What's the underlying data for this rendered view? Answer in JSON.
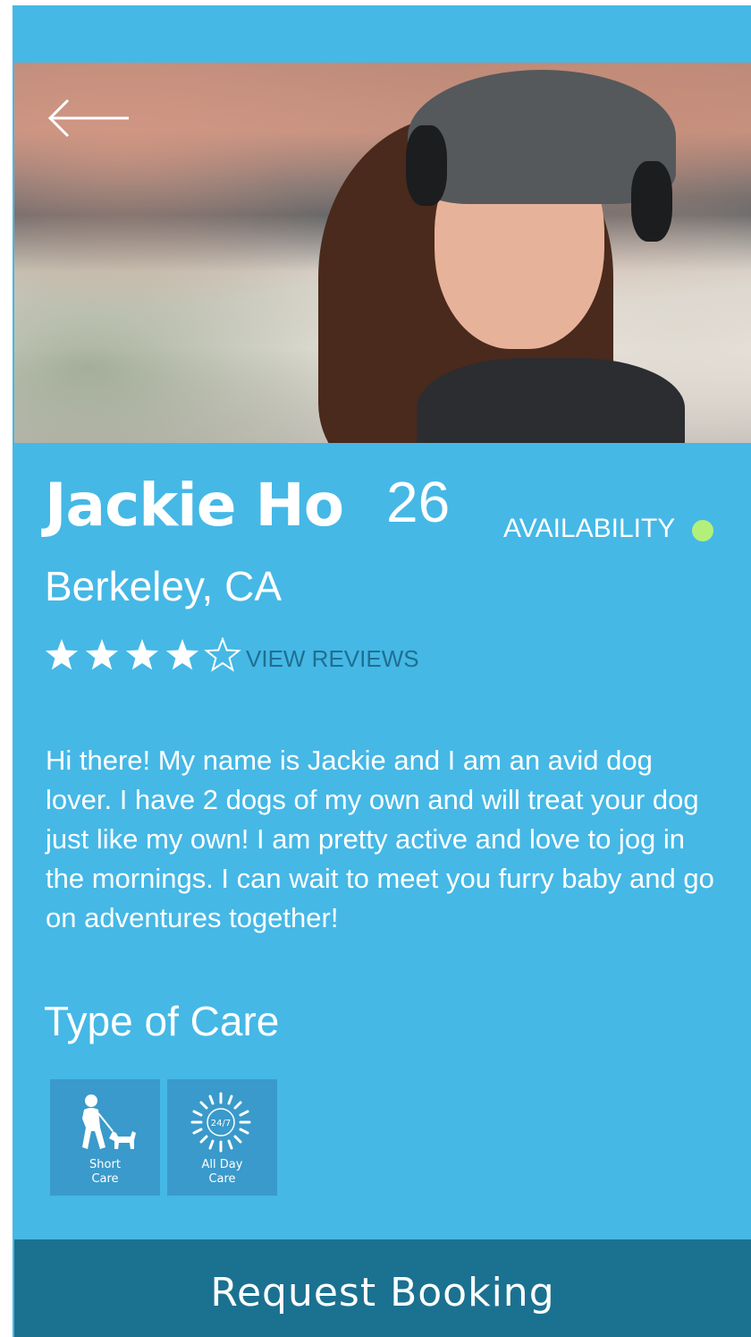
{
  "profile": {
    "name": "Jackie Ho",
    "age": "26",
    "location": "Berkeley, CA",
    "availability_label": "AVAILABILITY",
    "availability_color": "#b2f07a",
    "rating": 4,
    "rating_max": 5,
    "view_reviews_label": "VIEW REVIEWS",
    "bio": "Hi there! My name is Jackie and I am an avid dog lover. I have 2 dogs of my own and will treat your dog just like my own! I am pretty active and love to jog in the mornings. I can wait to meet you furry baby and go on adventures together!"
  },
  "care": {
    "heading": "Type of Care",
    "options": [
      {
        "label": "Short\nCare",
        "icon": "person-walking-dog-icon"
      },
      {
        "label": "All Day\nCare",
        "icon": "sun-24-7-icon",
        "icon_text": "24/7"
      }
    ]
  },
  "actions": {
    "request_booking_label": "Request Booking"
  },
  "icons": {
    "back": "back-arrow-icon",
    "star_filled": "star-filled-icon",
    "star_empty": "star-outline-icon"
  },
  "colors": {
    "background": "#45b8e6",
    "tile": "#3a9acb",
    "booking_bar": "#1b7190",
    "link": "#1f6f91"
  }
}
